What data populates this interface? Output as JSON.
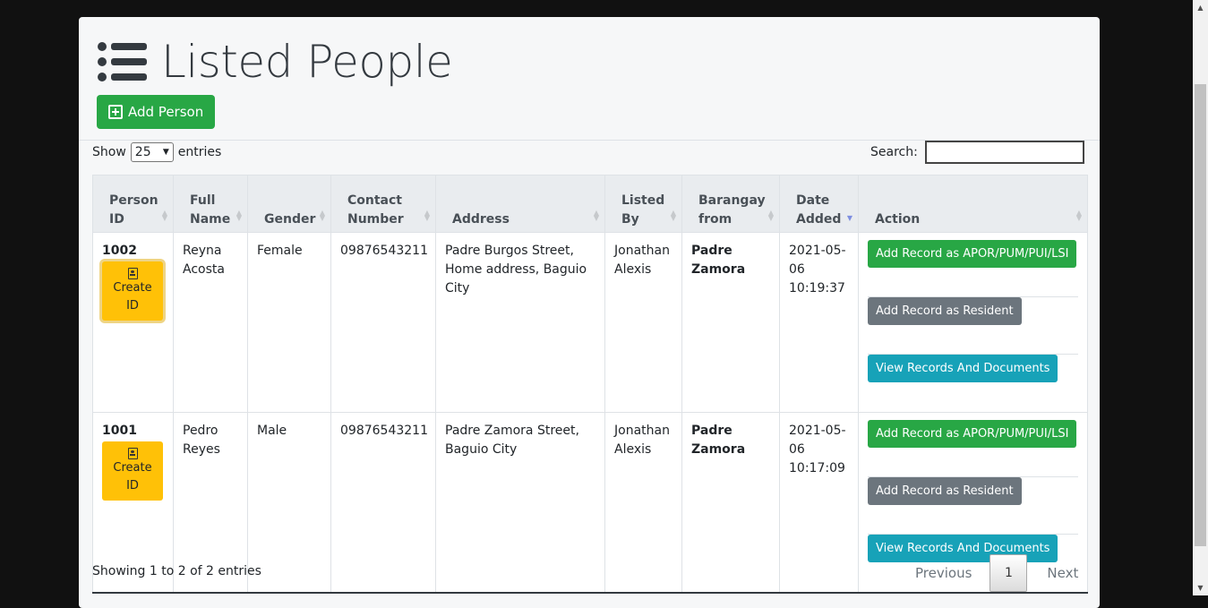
{
  "page": {
    "title": "Listed People",
    "add_button": "Add Person"
  },
  "length": {
    "prefix": "Show",
    "value": "25",
    "suffix": "entries"
  },
  "search": {
    "label": "Search:",
    "value": ""
  },
  "table": {
    "headers": {
      "person_id": [
        "Person",
        "ID"
      ],
      "full_name": [
        "Full",
        "Name"
      ],
      "gender": "Gender",
      "contact": [
        "Contact",
        "Number"
      ],
      "address": "Address",
      "listed_by": [
        "Listed",
        "By"
      ],
      "barangay": [
        "Barangay",
        "from"
      ],
      "date_added": [
        "Date",
        "Added"
      ],
      "action": "Action"
    },
    "rows": [
      {
        "id": "1002",
        "id_button": [
          "Create",
          "ID"
        ],
        "name": [
          "Reyna",
          "Acosta"
        ],
        "gender": "Female",
        "contact": "09876543211",
        "address": [
          "Padre Burgos Street,",
          "Home address, Baguio",
          "City"
        ],
        "listed_by": [
          "Jonathan",
          "Alexis"
        ],
        "barangay": [
          "Padre",
          "Zamora"
        ],
        "date": [
          "2021-05-",
          "06",
          "10:19:37"
        ],
        "actions": [
          "Add Record as APOR/PUM/PUI/LSI",
          "Add Record as Resident",
          "View Records And Documents"
        ]
      },
      {
        "id": "1001",
        "id_button": [
          "Create",
          "ID"
        ],
        "name": [
          "Pedro",
          "Reyes"
        ],
        "gender": "Male",
        "contact": "09876543211",
        "address": [
          "Padre Zamora Street,",
          "Baguio City"
        ],
        "listed_by": [
          "Jonathan",
          "Alexis"
        ],
        "barangay": [
          "Padre",
          "Zamora"
        ],
        "date": [
          "2021-05-",
          "06",
          "10:17:09"
        ],
        "actions": [
          "Add Record as APOR/PUM/PUI/LSI",
          "Add Record as Resident",
          "View Records And Documents"
        ]
      }
    ]
  },
  "footer": {
    "info": "Showing 1 to 2 of 2 entries",
    "prev": "Previous",
    "page": "1",
    "next": "Next"
  },
  "colors": {
    "success": "#28a745",
    "warning": "#ffc107",
    "secondary": "#6c757d",
    "info": "#17a2b8"
  },
  "icons": {
    "title": "list-icon",
    "add": "plus-square-icon",
    "id": "id-badge-icon"
  }
}
